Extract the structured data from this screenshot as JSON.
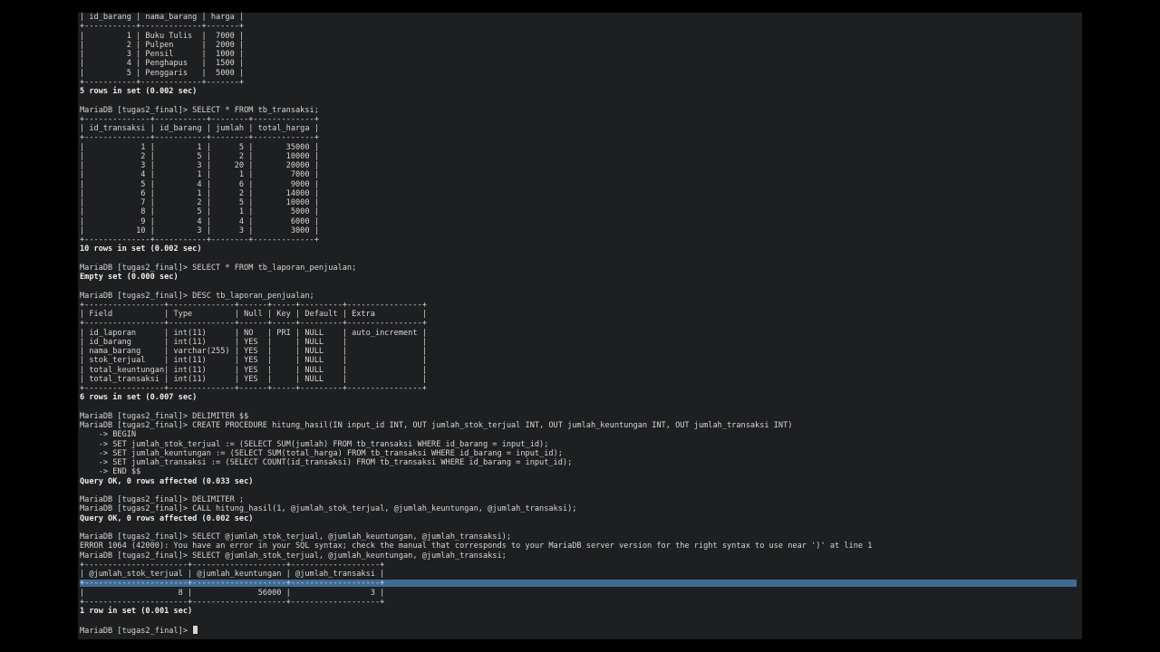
{
  "terminal": {
    "lines": [
      {
        "t": "| id_barang | nama_barang | harga |",
        "b": false
      },
      {
        "t": "+-----------+-------------+-------+",
        "b": false
      },
      {
        "t": "|         1 | Buku Tulis  |  7000 |",
        "b": false
      },
      {
        "t": "|         2 | Pulpen      |  2000 |",
        "b": false
      },
      {
        "t": "|         3 | Pensil      |  1000 |",
        "b": false
      },
      {
        "t": "|         4 | Penghapus   |  1500 |",
        "b": false
      },
      {
        "t": "|         5 | Penggaris   |  5000 |",
        "b": false
      },
      {
        "t": "+-----------+-------------+-------+",
        "b": false
      },
      {
        "t": "5 rows in set (0.002 sec)",
        "b": true
      },
      {
        "t": "",
        "b": false
      },
      {
        "t": "MariaDB [tugas2_final]> SELECT * FROM tb_transaksi;",
        "b": false
      },
      {
        "t": "+--------------+-----------+--------+-------------+",
        "b": false
      },
      {
        "t": "| id_transaksi | id_barang | jumlah | total_harga |",
        "b": false
      },
      {
        "t": "+--------------+-----------+--------+-------------+",
        "b": false
      },
      {
        "t": "|            1 |         1 |      5 |       35000 |",
        "b": false
      },
      {
        "t": "|            2 |         5 |      2 |       10000 |",
        "b": false
      },
      {
        "t": "|            3 |         3 |     20 |       20000 |",
        "b": false
      },
      {
        "t": "|            4 |         1 |      1 |        7000 |",
        "b": false
      },
      {
        "t": "|            5 |         4 |      6 |        9000 |",
        "b": false
      },
      {
        "t": "|            6 |         1 |      2 |       14000 |",
        "b": false
      },
      {
        "t": "|            7 |         2 |      5 |       10000 |",
        "b": false
      },
      {
        "t": "|            8 |         5 |      1 |        5000 |",
        "b": false
      },
      {
        "t": "|            9 |         4 |      4 |        6000 |",
        "b": false
      },
      {
        "t": "|           10 |         3 |      3 |        3000 |",
        "b": false
      },
      {
        "t": "+--------------+-----------+--------+-------------+",
        "b": false
      },
      {
        "t": "10 rows in set (0.002 sec)",
        "b": true
      },
      {
        "t": "",
        "b": false
      },
      {
        "t": "MariaDB [tugas2_final]> SELECT * FROM tb_laporan_penjualan;",
        "b": false
      },
      {
        "t": "Empty set (0.000 sec)",
        "b": true
      },
      {
        "t": "",
        "b": false
      },
      {
        "t": "MariaDB [tugas2_final]> DESC tb_laporan_penjualan;",
        "b": false
      },
      {
        "t": "+-----------------+--------------+------+-----+---------+----------------+",
        "b": false
      },
      {
        "t": "| Field           | Type         | Null | Key | Default | Extra          |",
        "b": false
      },
      {
        "t": "+-----------------+--------------+------+-----+---------+----------------+",
        "b": false
      },
      {
        "t": "| id_laporan      | int(11)      | NO   | PRI | NULL    | auto_increment |",
        "b": false
      },
      {
        "t": "| id_barang       | int(11)      | YES  |     | NULL    |                |",
        "b": false
      },
      {
        "t": "| nama_barang     | varchar(255) | YES  |     | NULL    |                |",
        "b": false
      },
      {
        "t": "| stok_terjual    | int(11)      | YES  |     | NULL    |                |",
        "b": false
      },
      {
        "t": "| total_keuntungan| int(11)      | YES  |     | NULL    |                |",
        "b": false
      },
      {
        "t": "| total_transaksi | int(11)      | YES  |     | NULL    |                |",
        "b": false
      },
      {
        "t": "+-----------------+--------------+------+-----+---------+----------------+",
        "b": false
      },
      {
        "t": "6 rows in set (0.007 sec)",
        "b": true
      },
      {
        "t": "",
        "b": false
      },
      {
        "t": "MariaDB [tugas2_final]> DELIMITER $$",
        "b": false
      },
      {
        "t": "MariaDB [tugas2_final]> CREATE PROCEDURE hitung_hasil(IN input_id INT, OUT jumlah_stok_terjual INT, OUT jumlah_keuntungan INT, OUT jumlah_transaksi INT)",
        "b": false
      },
      {
        "t": "    -> BEGIN",
        "b": false
      },
      {
        "t": "    -> SET jumlah_stok_terjual := (SELECT SUM(jumlah) FROM tb_transaksi WHERE id_barang = input_id);",
        "b": false
      },
      {
        "t": "    -> SET jumlah_keuntungan := (SELECT SUM(total_harga) FROM tb_transaksi WHERE id_barang = input_id);",
        "b": false
      },
      {
        "t": "    -> SET jumlah_transaksi := (SELECT COUNT(id_transaksi) FROM tb_transaksi WHERE id_barang = input_id);",
        "b": false
      },
      {
        "t": "    -> END $$",
        "b": false
      },
      {
        "t": "Query OK, 0 rows affected (0.033 sec)",
        "b": true
      },
      {
        "t": "",
        "b": false
      },
      {
        "t": "MariaDB [tugas2_final]> DELIMITER ;",
        "b": false
      },
      {
        "t": "MariaDB [tugas2_final]> CALL hitung_hasil(1, @jumlah_stok_terjual, @jumlah_keuntungan, @jumlah_transaksi);",
        "b": false
      },
      {
        "t": "Query OK, 0 rows affected (0.002 sec)",
        "b": true
      },
      {
        "t": "",
        "b": false
      },
      {
        "t": "MariaDB [tugas2_final]> SELECT @jumlah_stok_terjual, @jumlah_keuntungan, @jumlah_transaksi);",
        "b": false
      },
      {
        "t": "ERROR 1064 (42000): You have an error in your SQL syntax; check the manual that corresponds to your MariaDB server version for the right syntax to use near ')' at line 1",
        "b": false
      },
      {
        "t": "MariaDB [tugas2_final]> SELECT @jumlah_stok_terjual, @jumlah_keuntungan, @jumlah_transaksi;",
        "b": false
      },
      {
        "t": "+----------------------+--------------------+-------------------+",
        "b": false
      },
      {
        "t": "| @jumlah_stok_terjual | @jumlah_keuntungan | @jumlah_transaksi |",
        "b": false
      },
      {
        "t": "+----------------------+--------------------+-------------------+",
        "b": false,
        "sel": true
      },
      {
        "t": "|                    8 |              56000 |                 3 |",
        "b": false
      },
      {
        "t": "+----------------------+--------------------+-------------------+",
        "b": false
      },
      {
        "t": "1 row in set (0.001 sec)",
        "b": true
      },
      {
        "t": "",
        "b": false
      },
      {
        "t": "MariaDB [tugas2_final]> ",
        "b": false,
        "prompt": true
      }
    ]
  },
  "colors": {
    "background": "#000000",
    "terminal_bg": "#1e1f21",
    "text": "#d6d6d6",
    "selection": "#3f6a96"
  }
}
